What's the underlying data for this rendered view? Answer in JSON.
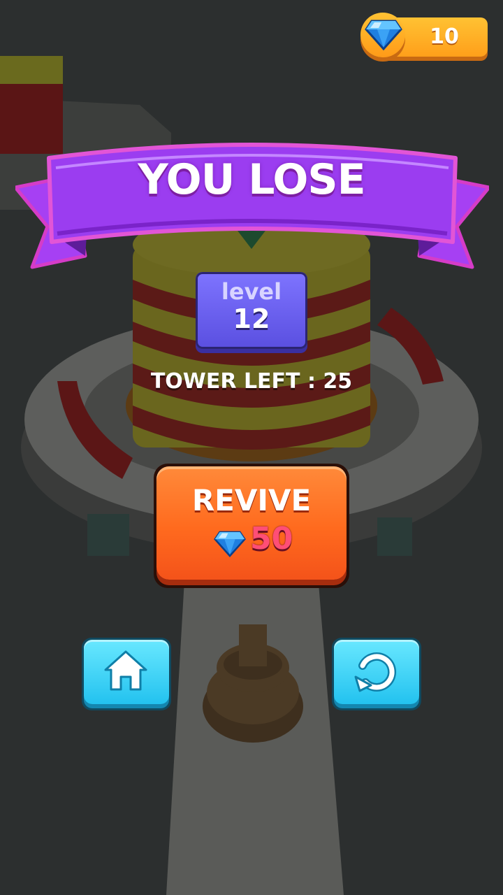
{
  "hud": {
    "gem_count": "10"
  },
  "result": {
    "title": "YOU LOSE",
    "level_label": "level",
    "level_number": "12",
    "tower_left": "TOWER LEFT : 25"
  },
  "revive": {
    "label": "REVIVE",
    "cost": "50"
  },
  "nav": {
    "home_icon": "home-icon",
    "restart_icon": "restart-icon"
  },
  "colors": {
    "ribbon": "#9b3df0",
    "revive": "#ff6a1e",
    "gem_panel": "#ffb020",
    "level_badge": "#6a60f0",
    "nav_button": "#3ed3f8"
  }
}
